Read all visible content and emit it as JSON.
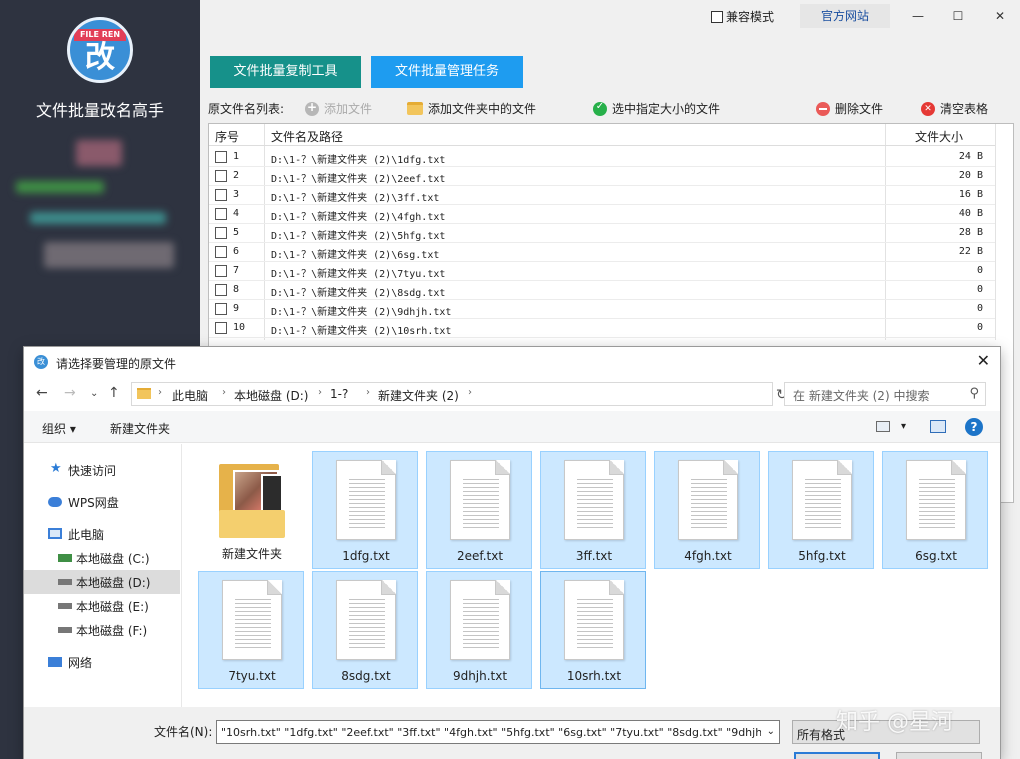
{
  "app": {
    "logo_text": "FILE REN",
    "logo_char": "改",
    "name": "文件批量改名高手"
  },
  "window": {
    "compat_mode": "兼容模式",
    "official_site": "官方网站"
  },
  "tabs": [
    {
      "label": "文件批量复制工具"
    },
    {
      "label": "文件批量管理任务"
    }
  ],
  "toolbar": {
    "list_label": "原文件名列表:",
    "add_file": "添加文件",
    "add_folder_files": "添加文件夹中的文件",
    "select_by_size": "选中指定大小的文件",
    "delete_files": "删除文件",
    "clear_table": "清空表格"
  },
  "table": {
    "headers": {
      "no": "序号",
      "path": "文件名及路径",
      "size": "文件大小"
    },
    "rows": [
      {
        "no": "1",
        "path": "D:\\1-？\\新建文件夹 (2)\\1dfg.txt",
        "size": "24 B"
      },
      {
        "no": "2",
        "path": "D:\\1-？\\新建文件夹 (2)\\2eef.txt",
        "size": "20 B"
      },
      {
        "no": "3",
        "path": "D:\\1-？\\新建文件夹 (2)\\3ff.txt",
        "size": "16 B"
      },
      {
        "no": "4",
        "path": "D:\\1-？\\新建文件夹 (2)\\4fgh.txt",
        "size": "40 B"
      },
      {
        "no": "5",
        "path": "D:\\1-？\\新建文件夹 (2)\\5hfg.txt",
        "size": "28 B"
      },
      {
        "no": "6",
        "path": "D:\\1-？\\新建文件夹 (2)\\6sg.txt",
        "size": "22 B"
      },
      {
        "no": "7",
        "path": "D:\\1-？\\新建文件夹 (2)\\7tyu.txt",
        "size": "0"
      },
      {
        "no": "8",
        "path": "D:\\1-？\\新建文件夹 (2)\\8sdg.txt",
        "size": "0"
      },
      {
        "no": "9",
        "path": "D:\\1-？\\新建文件夹 (2)\\9dhjh.txt",
        "size": "0"
      },
      {
        "no": "10",
        "path": "D:\\1-？\\新建文件夹 (2)\\10srh.txt",
        "size": "0"
      }
    ]
  },
  "dialog": {
    "title": "请选择要管理的原文件",
    "breadcrumb": [
      "此电脑",
      "本地磁盘 (D:)",
      "1-?",
      "新建文件夹 (2)"
    ],
    "search_placeholder": "在 新建文件夹 (2) 中搜索",
    "organize": "组织 ▾",
    "new_folder": "新建文件夹",
    "nav": {
      "quick_access": "快速访问",
      "wps_drive": "WPS网盘",
      "this_pc": "此电脑",
      "drive_c": "本地磁盘 (C:)",
      "drive_d": "本地磁盘 (D:)",
      "drive_e": "本地磁盘 (E:)",
      "drive_f": "本地磁盘 (F:)",
      "network": "网络"
    },
    "files": [
      {
        "name": "新建文件夹"
      },
      {
        "name": "1dfg.txt"
      },
      {
        "name": "2eef.txt"
      },
      {
        "name": "3ff.txt"
      },
      {
        "name": "4fgh.txt"
      },
      {
        "name": "5hfg.txt"
      },
      {
        "name": "6sg.txt"
      },
      {
        "name": "7tyu.txt"
      },
      {
        "name": "8sdg.txt"
      },
      {
        "name": "9dhjh.txt"
      },
      {
        "name": "10srh.txt"
      }
    ],
    "filename_label": "文件名(N):",
    "filename_value": "\"10srh.txt\" \"1dfg.txt\" \"2eef.txt\" \"3ff.txt\" \"4fgh.txt\" \"5hfg.txt\" \"6sg.txt\" \"7tyu.txt\" \"8sdg.txt\" \"9dhjh",
    "filter_value": "所有格式"
  },
  "watermark": "知乎 @星河",
  "colors": {
    "sidebar_bg": "#2e3340",
    "tab_copy": "#16918a",
    "tab_manage": "#1e9cf0",
    "selection": "#cce8ff"
  }
}
